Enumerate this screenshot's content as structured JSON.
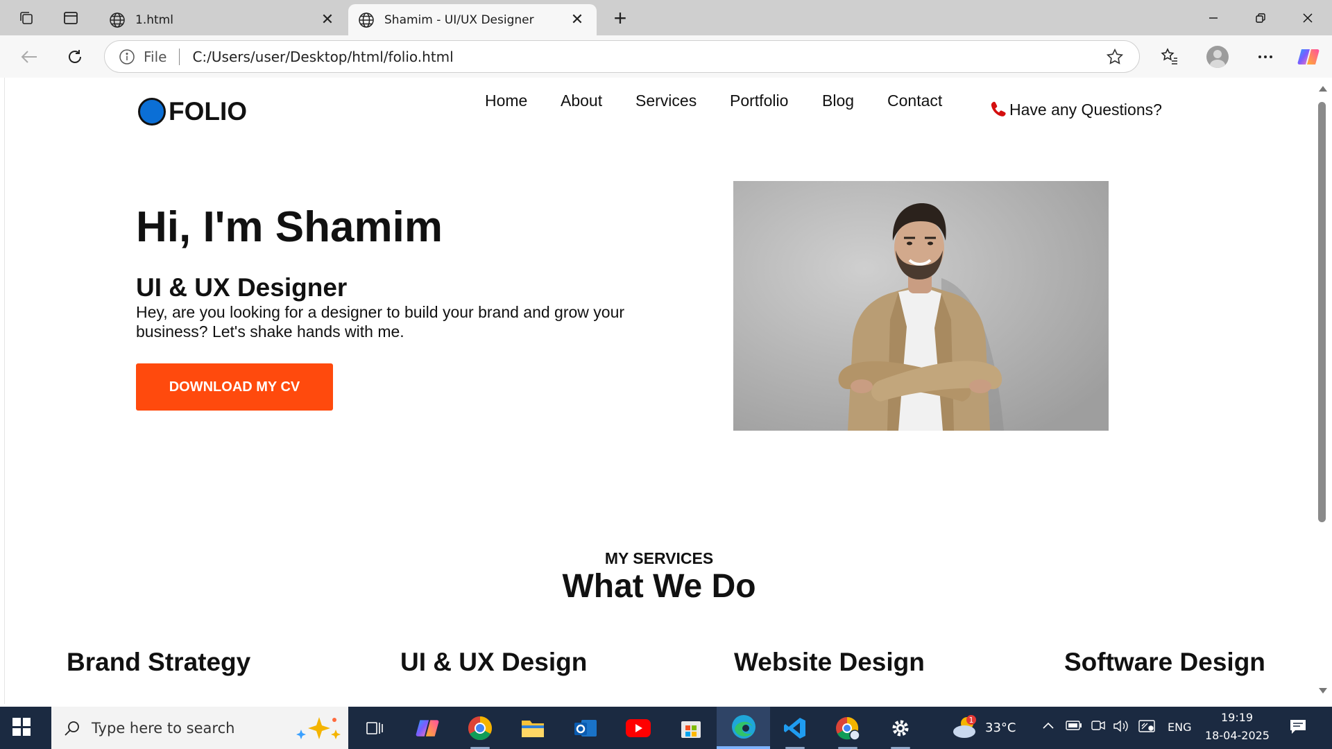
{
  "browser": {
    "tabs": [
      {
        "title": "1.html",
        "active": false
      },
      {
        "title": "Shamim - UI/UX Designer",
        "active": true
      }
    ],
    "address": {
      "scheme_label": "File",
      "url": "C:/Users/user/Desktop/html/folio.html"
    }
  },
  "site": {
    "logo": "FOLIO",
    "nav": [
      "Home",
      "About",
      "Services",
      "Portfolio",
      "Blog",
      "Contact"
    ],
    "question": "Have any Questions?",
    "hero": {
      "title": "Hi, I'm Shamim",
      "role": "UI & UX Designer",
      "description": "Hey, are you looking for a designer to build your brand and grow your business? Let's shake hands with me.",
      "cta": "DOWNLOAD MY CV"
    },
    "services": {
      "kicker": "MY SERVICES",
      "title": "What We Do",
      "items": [
        "Brand Strategy",
        "UI & UX Design",
        "Website Design",
        "Software Design"
      ]
    }
  },
  "taskbar": {
    "search_placeholder": "Type here to search",
    "weather": {
      "temp": "33°C",
      "badge": "1"
    },
    "language": "ENG",
    "time": "19:19",
    "date": "18-04-2025"
  },
  "colors": {
    "accent": "#ff4a0d",
    "logo_dot": "#0b6fd6",
    "taskbar": "#1b2a41"
  }
}
